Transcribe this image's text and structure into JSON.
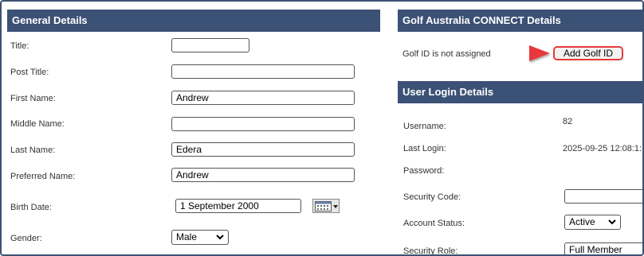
{
  "general": {
    "header": "General Details",
    "title_label": "Title:",
    "title_value": "",
    "post_title_label": "Post Title:",
    "post_title_value": "",
    "first_name_label": "First Name:",
    "first_name_value": "Andrew",
    "middle_name_label": "Middle Name:",
    "middle_name_value": "",
    "last_name_label": "Last Name:",
    "last_name_value": "Edera",
    "preferred_name_label": "Preferred Name:",
    "preferred_name_value": "Andrew",
    "birth_date_label": "Birth Date:",
    "birth_date_value": "1 September 2000",
    "gender_label": "Gender:",
    "gender_value": "Male"
  },
  "golf": {
    "header": "Golf Australia CONNECT Details",
    "status_text": "Golf ID is not assigned",
    "add_button_label": "Add Golf ID",
    "arrow_color": "#e8393a"
  },
  "login": {
    "header": "User Login Details",
    "username_label": "Username:",
    "username_value": "82",
    "last_login_label": "Last Login:",
    "last_login_value": "2025-09-25 12:08:1:",
    "password_label": "Password:",
    "security_code_label": "Security Code:",
    "security_code_value": "",
    "account_status_label": "Account Status:",
    "account_status_value": "Active",
    "security_role_label": "Security Role:",
    "security_role_value": "Full Member"
  },
  "icons": {
    "calendar": "calendar-icon",
    "dropdown": "chevron-down-icon",
    "arrow": "arrow-right-icon"
  },
  "colors": {
    "header_bg": "#3c5176",
    "frame_border": "#3d5273",
    "highlight": "#e8393a"
  }
}
